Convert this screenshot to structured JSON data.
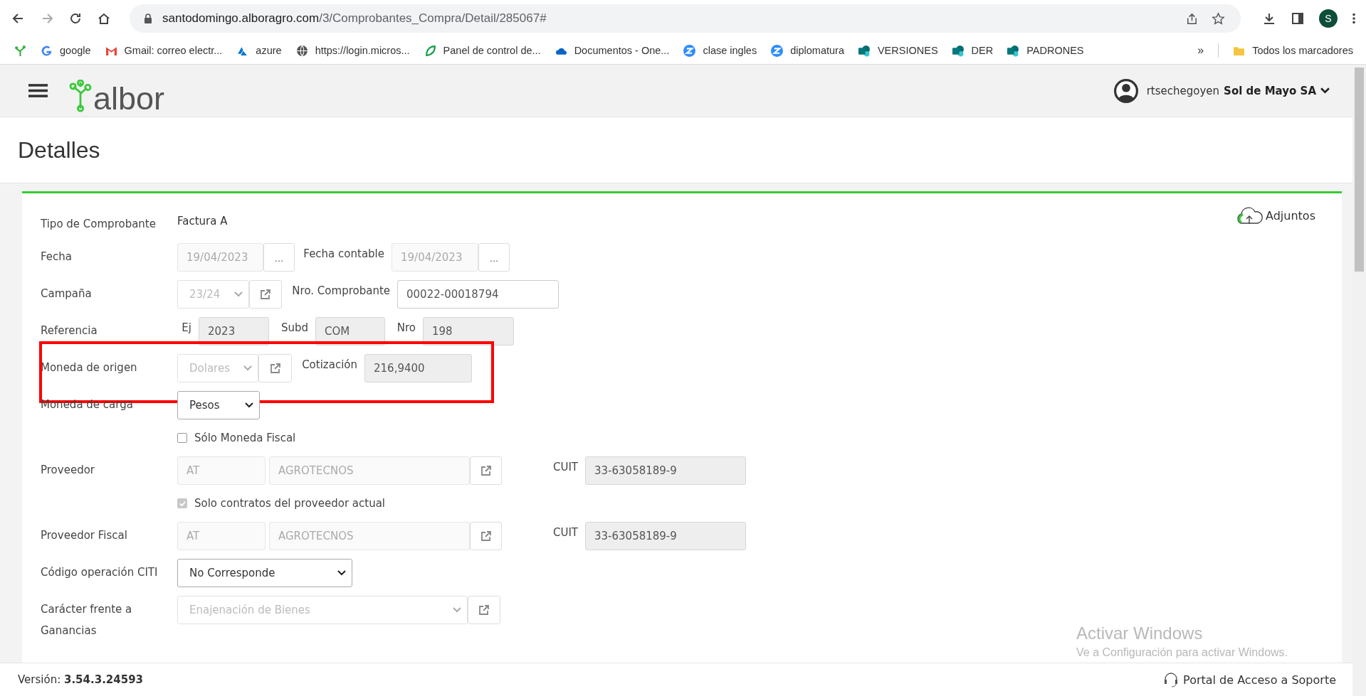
{
  "browser": {
    "url_host": "santodomingo.alboragro.com",
    "url_path": "/3/Comprobantes_Compra/Detail/285067#",
    "profile": "S",
    "bookmarks": [
      {
        "label": "google"
      },
      {
        "label": "Gmail: correo electr..."
      },
      {
        "label": "azure"
      },
      {
        "label": "https://login.micros..."
      },
      {
        "label": "Panel de control de..."
      },
      {
        "label": "Documentos - One..."
      },
      {
        "label": "clase ingles"
      },
      {
        "label": "diplomatura"
      },
      {
        "label": "VERSIONES"
      },
      {
        "label": "DER"
      },
      {
        "label": "PADRONES"
      }
    ],
    "more": "»",
    "all_bookmarks": "Todos los marcadores"
  },
  "header": {
    "logo_text": "albor",
    "user": "rtsechegoyen",
    "company": "Sol de Mayo SA"
  },
  "page_title": "Detalles",
  "attachments": "Adjuntos",
  "form_rows": [
    {
      "label": "Tipo de Comprobante",
      "highlighted": false,
      "controls": [
        {
          "kind": "text",
          "value": "Factura A"
        }
      ]
    },
    {
      "label": "Fecha",
      "highlighted": false,
      "controls": [
        {
          "kind": "input",
          "value": "19/04/2023",
          "disabled": true,
          "readonly": false
        },
        {
          "kind": "button",
          "value": "..."
        },
        {
          "kind": "label",
          "value": "Fecha contable"
        },
        {
          "kind": "input",
          "value": "19/04/2023",
          "disabled": true,
          "readonly": false
        },
        {
          "kind": "button",
          "value": "..."
        }
      ]
    },
    {
      "label": "Campaña",
      "highlighted": false,
      "controls": [
        {
          "kind": "select",
          "value": "23/24",
          "disabled": true
        },
        {
          "kind": "link"
        },
        {
          "kind": "label",
          "value": "Nro. Comprobante"
        },
        {
          "kind": "input",
          "value": "00022-00018794",
          "disabled": false,
          "readonly": false
        }
      ]
    },
    {
      "label": "Referencia",
      "highlighted": false,
      "controls": [
        {
          "kind": "label",
          "value": "Ej"
        },
        {
          "kind": "input",
          "value": "2023",
          "disabled": false,
          "readonly": true
        },
        {
          "kind": "label",
          "value": "Subd"
        },
        {
          "kind": "input",
          "value": "COM",
          "disabled": false,
          "readonly": true
        },
        {
          "kind": "label",
          "value": "Nro"
        },
        {
          "kind": "input",
          "value": "198",
          "disabled": false,
          "readonly": true
        }
      ]
    },
    {
      "label": "Moneda de origen",
      "highlighted": true,
      "controls": [
        {
          "kind": "select",
          "value": "Dolares",
          "disabled": true
        },
        {
          "kind": "link"
        },
        {
          "kind": "label",
          "value": "Cotización"
        },
        {
          "kind": "input",
          "value": "216,9400",
          "disabled": false,
          "readonly": true
        }
      ]
    },
    {
      "label": "Moneda de carga",
      "highlighted": false,
      "controls": [
        {
          "kind": "select",
          "value": "Pesos",
          "disabled": false
        }
      ]
    },
    {
      "highlighted": false,
      "controls": [
        {
          "kind": "checkbox",
          "value": "Sólo Moneda Fiscal",
          "checked": false,
          "disabled": false
        }
      ]
    },
    {
      "label": "Proveedor",
      "highlighted": false,
      "controls": [
        {
          "kind": "input",
          "value": "AT",
          "disabled": true,
          "readonly": false
        },
        {
          "kind": "input",
          "value": "AGROTECNOS",
          "disabled": true,
          "readonly": false
        },
        {
          "kind": "link"
        },
        {
          "kind": "label",
          "value": "CUIT"
        },
        {
          "kind": "input",
          "value": "33-63058189-9",
          "disabled": false,
          "readonly": true
        }
      ]
    },
    {
      "highlighted": false,
      "controls": [
        {
          "kind": "checkbox",
          "value": "Solo contratos del proveedor actual",
          "checked": true,
          "disabled": true
        }
      ]
    },
    {
      "label": "Proveedor Fiscal",
      "highlighted": false,
      "controls": [
        {
          "kind": "input",
          "value": "AT",
          "disabled": true,
          "readonly": false
        },
        {
          "kind": "input",
          "value": "AGROTECNOS",
          "disabled": true,
          "readonly": false
        },
        {
          "kind": "link"
        },
        {
          "kind": "label",
          "value": "CUIT"
        },
        {
          "kind": "input",
          "value": "33-63058189-9",
          "disabled": false,
          "readonly": true
        }
      ]
    },
    {
      "label": "Código operación CITI",
      "highlighted": false,
      "controls": [
        {
          "kind": "select",
          "value": "No Corresponde",
          "disabled": false
        }
      ]
    },
    {
      "label": "Carácter frente a Ganancias",
      "highlighted": false,
      "controls": [
        {
          "kind": "select",
          "value": "Enajenación de Bienes",
          "disabled": true
        },
        {
          "kind": "link"
        }
      ]
    }
  ],
  "footer": {
    "version": "Versión: **3.54.3.24593**",
    "support": "Portal de Acceso a Soporte"
  },
  "os_notice": {
    "title": "Activar Windows",
    "subtitle": "Ve a Configuración para activar Windows."
  }
}
